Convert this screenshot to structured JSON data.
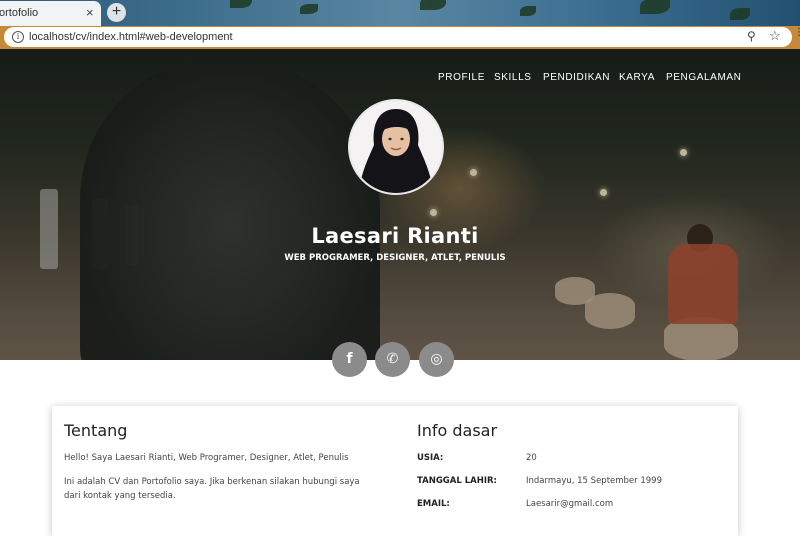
{
  "browser": {
    "tab_title": "ortofolio",
    "tab_close": "×",
    "new_tab": "+",
    "info_icon": "i",
    "url": "localhost/cv/index.html#web-development",
    "zoom_icon": "⚲",
    "star_icon": "☆",
    "menu_icon": "⋮"
  },
  "nav": {
    "items": [
      "PROFILE",
      "SKILLS",
      "PENDIDIKAN",
      "KARYA",
      "PENGALAMAN"
    ]
  },
  "hero": {
    "name": "Laesari Rianti",
    "tagline": "WEB PROGRAMER, DESIGNER, ATLET, PENULIS"
  },
  "social": {
    "facebook": "f",
    "whatsapp": "✆",
    "instagram": "◎"
  },
  "about": {
    "title": "Tentang",
    "p1": "Hello! Saya Laesari Rianti, Web Programer, Designer, Atlet, Penulis",
    "p2_line1": "Ini adalah CV dan Portofolio saya. Jika berkenan silakan hubungi saya",
    "p2_line2": "dari kontak yang tersedia."
  },
  "info": {
    "title": "Info dasar",
    "rows": [
      {
        "label": "USIA:",
        "value": "20"
      },
      {
        "label": "TANGGAL LAHIR:",
        "value": "Indarmayu, 15 September 1999"
      },
      {
        "label": "EMAIL:",
        "value": "Laesarir@gmail.com"
      }
    ]
  },
  "colors": {
    "toolbar": "#c48a3a",
    "social_button": "#8b8b8b"
  }
}
